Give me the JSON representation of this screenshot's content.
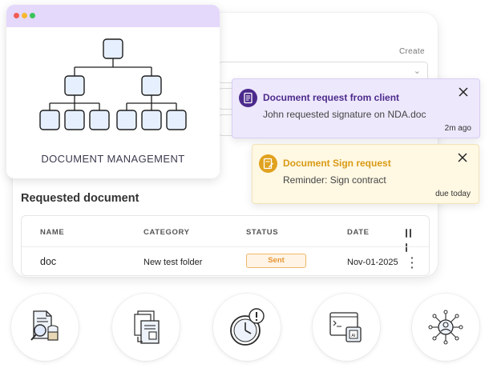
{
  "form": {
    "create_label": "Create"
  },
  "dm_card": {
    "title": "DOCUMENT MANAGEMENT",
    "window_dots": [
      "#f25c54",
      "#f7b731",
      "#3bc45a"
    ],
    "icon": "org-chart-icon"
  },
  "requested": {
    "title": "Requested document",
    "columns": [
      "NAME",
      "CATEGORY",
      "STATUS",
      "DATE"
    ],
    "rows": [
      {
        "name": "doc",
        "category": "New test folder",
        "status": "Sent",
        "date": "Nov-01-2025"
      }
    ]
  },
  "notifications": [
    {
      "title": "Document request from client",
      "body": "John requested signature on NDA.doc",
      "time": "2m ago",
      "accent": "#4b2a8c",
      "icon": "document-icon"
    },
    {
      "title": "Document Sign request",
      "body": "Reminder: Sign contract",
      "time": "due today",
      "accent": "#e0a21f",
      "icon": "sign-document-icon"
    }
  ],
  "feature_icons": [
    "document-search-icon",
    "document-workflow-icon",
    "clock-alert-icon",
    "ai-processing-icon",
    "automation-gear-icon"
  ]
}
